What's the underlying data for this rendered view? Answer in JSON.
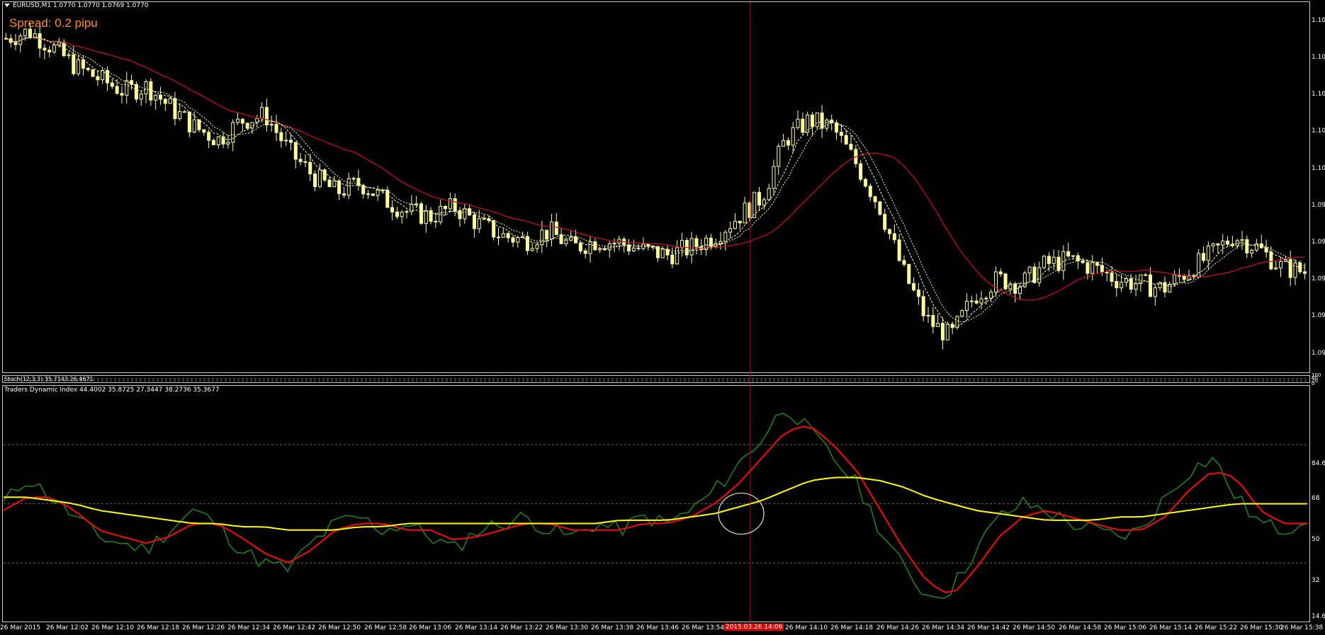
{
  "main_pane": {
    "symbol_line": "EURUSD,M1  1.0770 1.0770 1.0769 1.0770",
    "spread_text": "Spread: 0.2 pipu",
    "y_ticks": [
      "1.10",
      "1.10",
      "1.10",
      "1.10",
      "1.10",
      "1.09",
      "1.09",
      "1.09",
      "1.09",
      "1.09"
    ]
  },
  "stoch_pane": {
    "label": "Stoch(12,3,3) 35.7143 26.4671",
    "y_ticks": [
      "100",
      "80",
      "20",
      "0"
    ]
  },
  "tdi_pane": {
    "label": "Traders Dynamic Index 44.4002 35.8725 27.3447 38.2736 35.3677",
    "y_ticks": [
      "84.6",
      "68",
      "50",
      "32",
      "14.6"
    ]
  },
  "x_axis": {
    "labels": [
      "26 Mar 2015",
      "26 Mar 12:02",
      "26 Mar 12:10",
      "26 Mar 12:18",
      "26 Mar 12:26",
      "26 Mar 12:34",
      "26 Mar 12:42",
      "26 Mar 12:50",
      "26 Mar 12:58",
      "26 Mar 13:06",
      "26 Mar 13:14",
      "26 Mar 13:22",
      "26 Mar 13:30",
      "26 Mar 13:38",
      "26 Mar 13:46",
      "26 Mar 13:54",
      "26 Mar 14:10",
      "26 Mar 14:18",
      "26 Mar 14:26",
      "26 Mar 14:34",
      "26 Mar 14:42",
      "26 Mar 14:50",
      "26 Mar 14:58",
      "26 Mar 15:06",
      "26 Mar 15:14",
      "26 Mar 15:22",
      "26 Mar 15:30",
      "26 Mar 15:38"
    ],
    "crosshair_label": "2015.03.26 14:06"
  },
  "colors": {
    "candle": "#ffffa0",
    "ma_slow": "#c8102e",
    "ma_fast": "#ffffc0",
    "tdi_green": "#228b22",
    "tdi_red": "#e01010",
    "tdi_yellow": "#ffff00",
    "crosshair": "#b01010",
    "spread": "#ff8c1a"
  },
  "chart_data": [
    {
      "type": "candlestick",
      "title": "EURUSD,M1",
      "series": [
        {
          "name": "EURUSD",
          "values": [
            1.1032,
            1.1035,
            1.1028,
            1.102,
            1.1015,
            1.101,
            1.1012,
            1.1003,
            1.0995,
            1.099,
            1.0998,
            1.1,
            1.0985,
            1.0975,
            1.0968,
            1.0972,
            1.0965,
            1.096,
            1.0958,
            1.0962,
            1.0955,
            1.095,
            1.0948,
            1.0952,
            1.0945,
            1.0948,
            1.0947,
            1.0944,
            1.0942,
            1.0945,
            1.095,
            1.0958,
            1.0966,
            1.099,
            1.0998,
            1.0995,
            1.098,
            1.0962,
            1.0935,
            1.0915,
            1.0908,
            1.0925,
            1.0932,
            1.093,
            1.0938,
            1.094,
            1.0937,
            1.0932,
            1.093,
            1.0928,
            1.0935,
            1.0942,
            1.095,
            1.0945,
            1.0937,
            1.0935
          ]
        }
      ]
    },
    {
      "type": "line",
      "title": "Traders Dynamic Index",
      "ylim": [
        14.6,
        84.6
      ],
      "series": [
        {
          "name": "RSI",
          "values": [
            50,
            58,
            52,
            46,
            40,
            38,
            36,
            42,
            48,
            44,
            36,
            32,
            30,
            38,
            44,
            46,
            42,
            44,
            40,
            36,
            42,
            44,
            46,
            42,
            40,
            44,
            42,
            46,
            44,
            48,
            54,
            62,
            70,
            80,
            72,
            64,
            56,
            42,
            30,
            22,
            24,
            36,
            46,
            50,
            48,
            44,
            42,
            40,
            42,
            52,
            60,
            64,
            52,
            44,
            42,
            46
          ]
        },
        {
          "name": "Signal",
          "values": [
            48,
            52,
            52,
            48,
            42,
            40,
            38,
            40,
            44,
            44,
            40,
            35,
            32,
            36,
            42,
            44,
            44,
            42,
            42,
            39,
            40,
            42,
            44,
            44,
            42,
            42,
            42,
            44,
            44,
            46,
            50,
            56,
            64,
            72,
            74,
            68,
            60,
            48,
            36,
            26,
            22,
            30,
            40,
            46,
            48,
            46,
            44,
            42,
            42,
            46,
            54,
            60,
            58,
            48,
            44,
            44
          ]
        },
        {
          "name": "Market Base",
          "values": [
            52,
            52,
            51,
            50,
            48,
            47,
            46,
            45,
            44,
            44,
            43,
            43,
            42,
            42,
            42,
            43,
            43,
            44,
            44,
            44,
            44,
            44,
            44,
            44,
            44,
            44,
            45,
            45,
            45,
            46,
            47,
            49,
            51,
            54,
            57,
            58,
            58,
            57,
            55,
            52,
            50,
            48,
            47,
            46,
            45,
            45,
            45,
            46,
            46,
            47,
            48,
            49,
            50,
            50,
            50,
            50
          ]
        }
      ]
    }
  ]
}
